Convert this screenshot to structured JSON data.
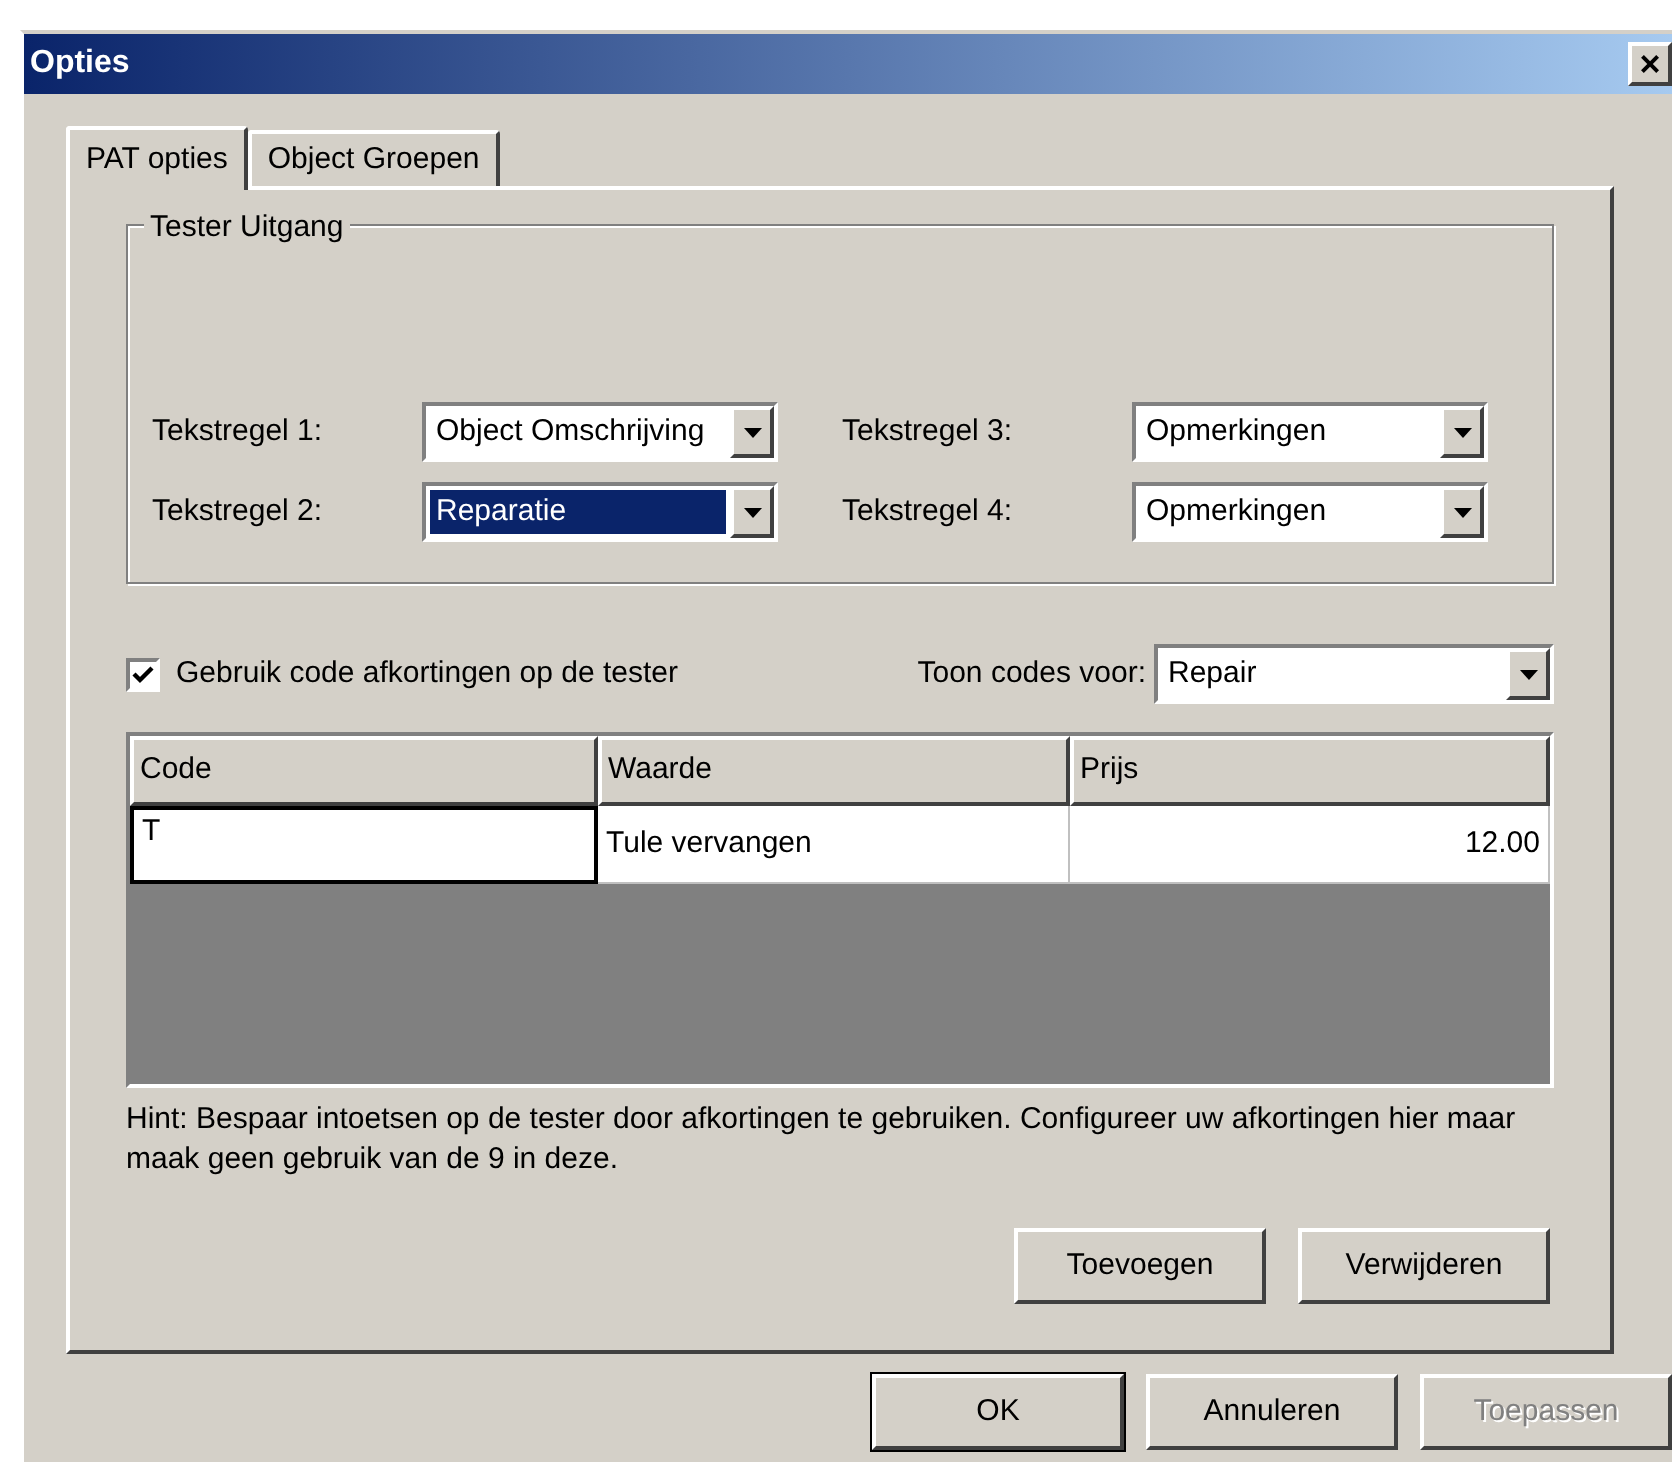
{
  "window": {
    "title": "Opties",
    "close": "×"
  },
  "tabs": [
    {
      "label": "PAT opties",
      "selected": true
    },
    {
      "label": "Object Groepen",
      "selected": false
    }
  ],
  "group": {
    "title": "Tester Uitgang",
    "fields": [
      {
        "label": "Tekstregel 1:",
        "value": "Object Omschrijving",
        "highlighted": false
      },
      {
        "label": "Tekstregel 3:",
        "value": "Opmerkingen",
        "highlighted": false
      },
      {
        "label": "Tekstregel 2:",
        "value": "Reparatie",
        "highlighted": true
      },
      {
        "label": "Tekstregel 4:",
        "value": "Opmerkingen",
        "highlighted": false
      }
    ]
  },
  "checkbox": {
    "label": "Gebruik code afkortingen op de tester",
    "checked": true
  },
  "filter": {
    "label": "Toon codes voor:",
    "value": "Repair"
  },
  "table": {
    "columns": [
      "Code",
      "Waarde",
      "Prijs"
    ],
    "rows": [
      {
        "cells": [
          "T",
          "Tule vervangen",
          "12.00"
        ],
        "editing": true
      }
    ]
  },
  "hint": "Hint: Bespaar intoetsen op de tester door afkortingen te gebruiken. Configureer uw afkortingen hier maar maak geen gebruik van de 9 in deze.",
  "panel_buttons": [
    {
      "label": "Toevoegen",
      "disabled": false,
      "default": false
    },
    {
      "label": "Verwijderen",
      "disabled": false,
      "default": false
    }
  ],
  "buttons": [
    {
      "label": "OK",
      "disabled": false,
      "default": true
    },
    {
      "label": "Annuleren",
      "disabled": false,
      "default": false
    },
    {
      "label": "Toepassen",
      "disabled": true,
      "default": false
    }
  ]
}
